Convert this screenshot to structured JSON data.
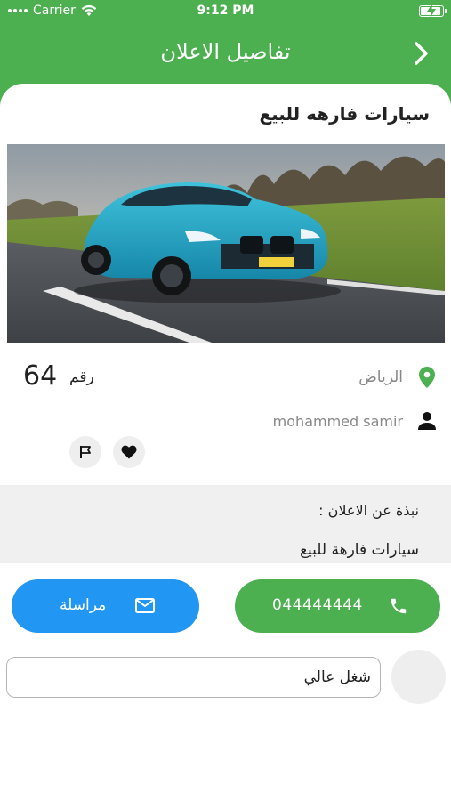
{
  "status_bar": {
    "carrier": "Carrier",
    "time": "9:12 PM"
  },
  "header": {
    "title": "تفاصيل الاعلان"
  },
  "ad": {
    "title": "سيارات فارهه للبيع",
    "price_label": "رقم",
    "price_value": "64",
    "city": "الرياض",
    "user": "mohammed samir"
  },
  "description": {
    "label": "نبذة عن الاعلان :",
    "text": "سيارات فارهة للبيع"
  },
  "actions": {
    "call_label": "044444444",
    "message_label": "مراسلة"
  },
  "comment": {
    "value": "شغل عالي"
  },
  "colors": {
    "brand_green": "#4caf50",
    "message_blue": "#2196f3",
    "panel_gray": "#f0f0f0"
  },
  "icons": [
    "wifi-icon",
    "battery-icon",
    "chevron-right-icon",
    "location-pin-icon",
    "user-icon",
    "flag-icon",
    "heart-icon",
    "phone-icon",
    "mail-icon"
  ]
}
